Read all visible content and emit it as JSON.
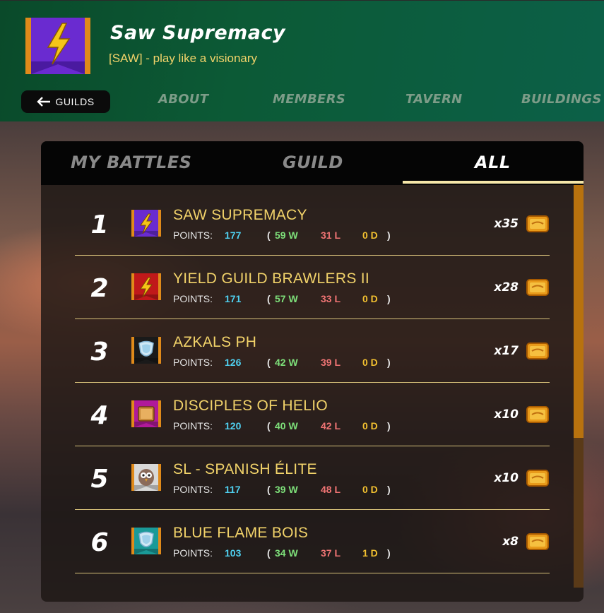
{
  "header": {
    "guild_name": "Saw Supremacy",
    "guild_motto": "[SAW] - play like a visionary",
    "banner_icon": "lightning-bolt-icon",
    "back_button": "GUILDS",
    "tabs": [
      "ABOUT",
      "MEMBERS",
      "TAVERN",
      "BUILDINGS"
    ]
  },
  "battle_tabs": {
    "items": [
      "MY BATTLES",
      "GUILD",
      "ALL"
    ],
    "active": "ALL"
  },
  "points_label": "POINTS:",
  "rows": [
    {
      "rank": "1",
      "name": "SAW SUPREMACY",
      "points": "177",
      "wins": "59 W",
      "losses": "31 L",
      "draws": "0 D",
      "multiplier": "x35",
      "flag_color": "#6a2bd0",
      "emblem": "lightning-bolt-icon"
    },
    {
      "rank": "2",
      "name": "YIELD GUILD BRAWLERS II",
      "points": "171",
      "wins": "57 W",
      "losses": "33 L",
      "draws": "0 D",
      "multiplier": "x28",
      "flag_color": "#c0191a",
      "emblem": "lightning-bolt-icon"
    },
    {
      "rank": "3",
      "name": "AZKALS PH",
      "points": "126",
      "wins": "42 W",
      "losses": "39 L",
      "draws": "0 D",
      "multiplier": "x17",
      "flag_color": "#1a1a1a",
      "emblem": "shield-icon"
    },
    {
      "rank": "4",
      "name": "DISCIPLES OF HELIO",
      "points": "120",
      "wins": "40 W",
      "losses": "42 L",
      "draws": "0 D",
      "multiplier": "x10",
      "flag_color": "#b01a9a",
      "emblem": "book-icon"
    },
    {
      "rank": "5",
      "name": "SL - SPANISH ÉLITE",
      "points": "117",
      "wins": "39 W",
      "losses": "48 L",
      "draws": "0 D",
      "multiplier": "x10",
      "flag_color": "#d8d8d8",
      "emblem": "owl-icon"
    },
    {
      "rank": "6",
      "name": "BLUE FLAME BOIS",
      "points": "103",
      "wins": "34 W",
      "losses": "37 L",
      "draws": "1 D",
      "multiplier": "x8",
      "flag_color": "#1a9a98",
      "emblem": "shield-icon"
    }
  ],
  "reward_icon": "gold-chest-icon",
  "colors": {
    "header_green": "#0c5a36",
    "gold_text": "#f2d36a",
    "points_blue": "#4fd0f0",
    "win_green": "#7ee07a",
    "loss_red": "#f07474",
    "draw_gold": "#f2c030",
    "scroll_orange": "#b8720e"
  }
}
